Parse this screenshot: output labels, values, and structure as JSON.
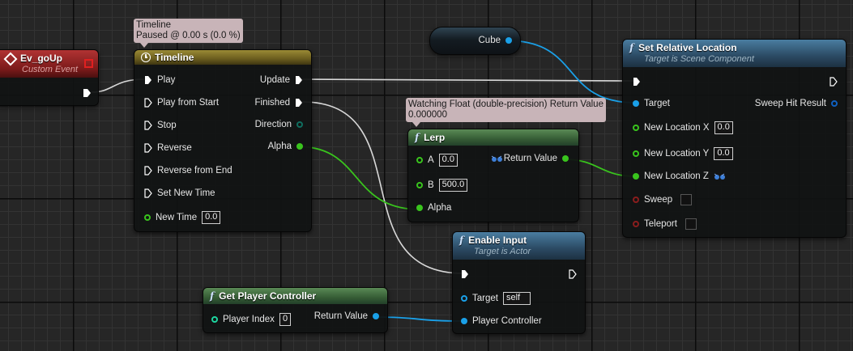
{
  "colors": {
    "exec_wire": "#d8d8d8",
    "float_pin": "#39c41d",
    "object_pin": "#1aa0e8",
    "bool_pin": "#8a1d1d",
    "func_header": "#2b4a63",
    "pure_header": "#355c35",
    "timeline_header": "#6b5d1e",
    "event_header": "#7a1a1a"
  },
  "event_node": {
    "title": "Ev_goUp",
    "subtitle": "Custom Event"
  },
  "timeline_tooltip": {
    "line1": "Timeline",
    "line2": "Paused @ 0.00 s (0.0 %)"
  },
  "timeline_node": {
    "title": "Timeline",
    "inputs": [
      "Play",
      "Play from Start",
      "Stop",
      "Reverse",
      "Reverse from End",
      "Set New Time"
    ],
    "new_time_label": "New Time",
    "new_time_value": "0.0",
    "outputs": {
      "update": "Update",
      "finished": "Finished",
      "direction": "Direction",
      "alpha": "Alpha"
    }
  },
  "cube_node": {
    "label": "Cube"
  },
  "set_location_node": {
    "title": "Set Relative Location",
    "subtitle": "Target is Scene Component",
    "target_label": "Target",
    "sweep_result_label": "Sweep Hit Result",
    "loc_x_label": "New Location X",
    "loc_x_value": "0.0",
    "loc_y_label": "New Location Y",
    "loc_y_value": "0.0",
    "loc_z_label": "New Location Z",
    "sweep_label": "Sweep",
    "teleport_label": "Teleport"
  },
  "lerp_tooltip": {
    "line1": "Watching Float (double-precision) Return Value",
    "line2": "0.000000"
  },
  "lerp_node": {
    "title": "Lerp",
    "a_label": "A",
    "a_value": "0.0",
    "b_label": "B",
    "b_value": "500.0",
    "alpha_label": "Alpha",
    "return_label": "Return Value"
  },
  "enable_input_node": {
    "title": "Enable Input",
    "subtitle": "Target is Actor",
    "target_label": "Target",
    "target_value": "self",
    "pc_label": "Player Controller"
  },
  "get_pc_node": {
    "title": "Get Player Controller",
    "index_label": "Player Index",
    "index_value": "0",
    "return_label": "Return Value"
  }
}
